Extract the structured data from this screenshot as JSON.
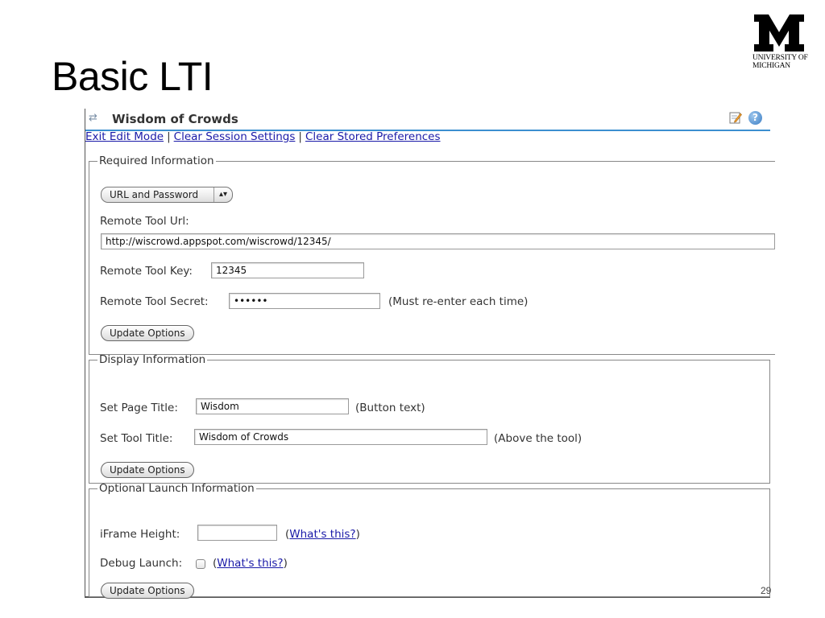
{
  "slide": {
    "title": "Basic LTI",
    "page_number": "29"
  },
  "logo": {
    "line1": "UNIVERSITY OF",
    "line2": "MICHIGAN",
    "letter": "M"
  },
  "portlet": {
    "title": "Wisdom of Crowds",
    "icons": [
      "swap-icon",
      "edit-icon",
      "help-icon"
    ],
    "links": {
      "exit_edit": "Exit Edit Mode",
      "clear_session": "Clear Session Settings",
      "clear_prefs": "Clear Stored Preferences",
      "separator": "|"
    }
  },
  "required": {
    "legend": "Required Information",
    "auth_select": "URL and Password",
    "url_label": "Remote Tool Url:",
    "url_value": "http://wiscrowd.appspot.com/wiscrowd/12345/",
    "key_label": "Remote Tool Key:",
    "key_value": "12345",
    "secret_label": "Remote Tool Secret:",
    "secret_value": "••••••",
    "secret_note": "(Must re-enter each time)",
    "update_button": "Update Options"
  },
  "display": {
    "legend": "Display Information",
    "page_title_label": "Set Page Title:",
    "page_title_value": "Wisdom",
    "page_title_note": "(Button text)",
    "tool_title_label": "Set Tool Title:",
    "tool_title_value": "Wisdom of Crowds",
    "tool_title_note": "(Above the tool)",
    "update_button": "Update Options"
  },
  "optional": {
    "legend": "Optional Launch Information",
    "iframe_label": "iFrame Height:",
    "iframe_value": "",
    "whats_this": "What's this?",
    "paren_open": "(",
    "paren_close": ")",
    "debug_label": "Debug Launch:",
    "debug_checked": false,
    "update_button": "Update Options"
  }
}
